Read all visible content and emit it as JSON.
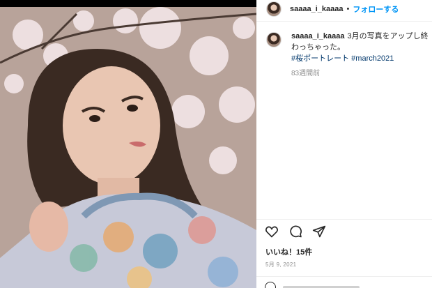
{
  "post": {
    "username": "saaaa_i_kaaaa",
    "separator": "•",
    "follow_label": "フォローする",
    "caption_text": "3月の写真をアップし終わっちゃった。",
    "hashtags": "#桜ポートレート #march2021",
    "time_ago": "83週間前",
    "likes": "いいね！15件",
    "date": "5月 9, 2021"
  },
  "icons": [
    "heart-icon",
    "comment-icon",
    "share-icon",
    "emoji-icon"
  ],
  "colors": {
    "accent": "#0095f6",
    "hashtag": "#00376b",
    "muted": "#8e8e8e",
    "text": "#262626"
  }
}
